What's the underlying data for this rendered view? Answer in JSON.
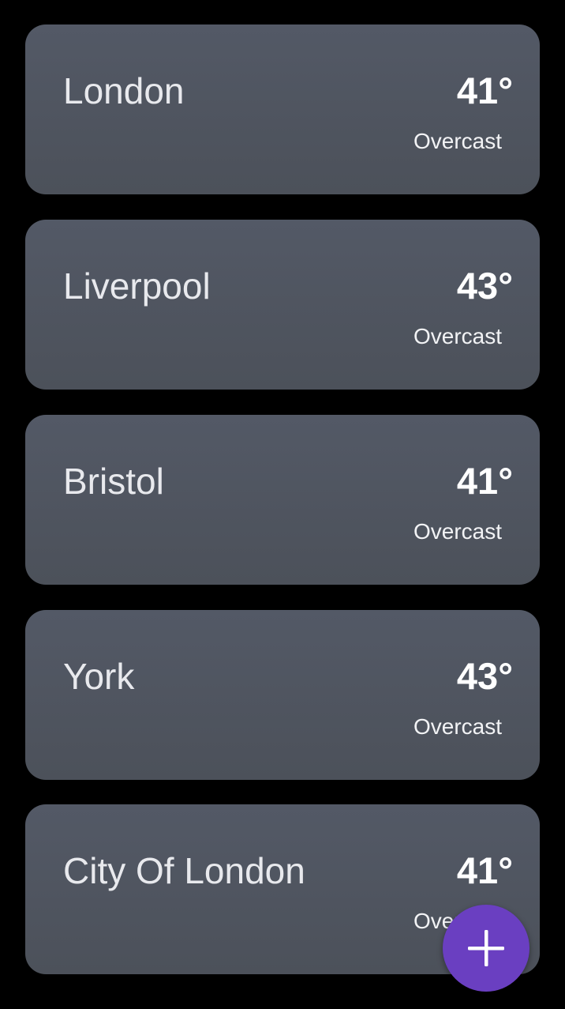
{
  "cities": [
    {
      "name": "London",
      "temperature": "41°",
      "condition": "Overcast"
    },
    {
      "name": "Liverpool",
      "temperature": "43°",
      "condition": "Overcast"
    },
    {
      "name": "Bristol",
      "temperature": "41°",
      "condition": "Overcast"
    },
    {
      "name": "York",
      "temperature": "43°",
      "condition": "Overcast"
    },
    {
      "name": "City Of London",
      "temperature": "41°",
      "condition": "Overcast"
    }
  ],
  "fab": {
    "icon": "plus-icon",
    "color": "#6a3fc1"
  },
  "colors": {
    "background": "#000000",
    "card": "#50555f"
  }
}
